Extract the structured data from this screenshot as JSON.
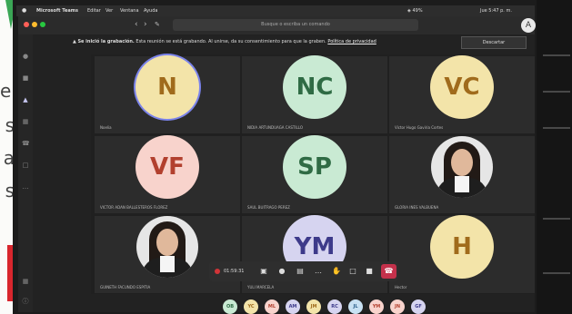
{
  "edge_fragments": [
    "el",
    "s",
    "a",
    "s"
  ],
  "menubar": {
    "app_name": "Microsoft Teams",
    "menus": [
      "Editar",
      "Ver",
      "Ventana",
      "Ayuda"
    ],
    "status": "49%",
    "clock": "Jue 5:47 p. m."
  },
  "titlebar": {
    "search_placeholder": "Busque o escriba un comando",
    "avatar_initial": "A"
  },
  "banner": {
    "bold_text": "Se inició la grabación.",
    "text": "Esta reunión se está grabando. Al unirse, da su consentimiento para que la graben.",
    "policy_link": "Política de privacidad",
    "dismiss": "Descartar"
  },
  "participants": [
    {
      "initials": "N",
      "name": "Noelia",
      "bg": "#f3e4a9",
      "fg": "#a06b1c",
      "photo": false,
      "active": true
    },
    {
      "initials": "NC",
      "name": "NIDIA ARTUNDUAGA CASTILLO",
      "bg": "#c9ead3",
      "fg": "#2f6b44",
      "photo": false
    },
    {
      "initials": "VC",
      "name": "Victor Hugo Gaviria Cortes",
      "bg": "#f3e4a9",
      "fg": "#a06b1c",
      "photo": false
    },
    {
      "initials": "VF",
      "name": "VICTOR ADAN BALLESTEROS FLOREZ",
      "bg": "#f8d3cc",
      "fg": "#b2402e",
      "photo": false
    },
    {
      "initials": "SP",
      "name": "SAUL BUITRAGO PEREZ",
      "bg": "#c9ead3",
      "fg": "#2f6b44",
      "photo": false
    },
    {
      "initials": "",
      "name": "GLORIA INES VALBUENA",
      "bg": "",
      "fg": "",
      "photo": true
    },
    {
      "initials": "",
      "name": "GUINETH FACUNDO ESPITIA",
      "bg": "",
      "fg": "",
      "photo": true
    },
    {
      "initials": "YM",
      "name": "YULI MARCELA",
      "bg": "#d6d4f0",
      "fg": "#3d3a8a",
      "photo": false
    },
    {
      "initials": "H",
      "name": "Hector",
      "bg": "#f3e4a9",
      "fg": "#a06b1c",
      "photo": false
    }
  ],
  "callbar": {
    "timer": "01:59:31",
    "hangup_icon": "phone-hangup-icon"
  },
  "strip": [
    {
      "t": "OB",
      "bg": "#c9ead3",
      "fg": "#2f6b44"
    },
    {
      "t": "YC",
      "bg": "#f3e4a9",
      "fg": "#a06b1c"
    },
    {
      "t": "ML",
      "bg": "#f8d3cc",
      "fg": "#b2402e"
    },
    {
      "t": "AM",
      "bg": "#d6d4f0",
      "fg": "#3d3a8a"
    },
    {
      "t": "JM",
      "bg": "#f3e4a9",
      "fg": "#a06b1c"
    },
    {
      "t": "RC",
      "bg": "#d6d4f0",
      "fg": "#3d3a8a"
    },
    {
      "t": "JL",
      "bg": "#c8e1f3",
      "fg": "#2b5f8a"
    },
    {
      "t": "YM",
      "bg": "#f8d3cc",
      "fg": "#b2402e"
    },
    {
      "t": "JN",
      "bg": "#f8d3cc",
      "fg": "#b2402e"
    },
    {
      "t": "GF",
      "bg": "#d6d4f0",
      "fg": "#3d3a8a"
    }
  ]
}
